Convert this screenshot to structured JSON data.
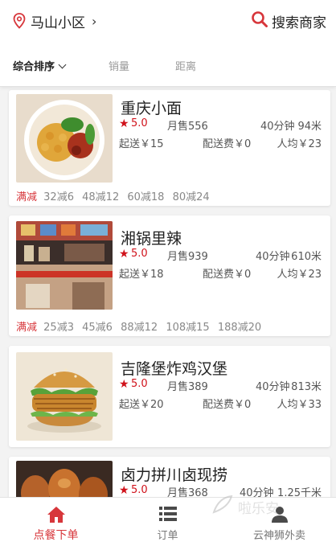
{
  "header": {
    "location": "马山小区",
    "search_label": "搜索商家"
  },
  "sort_tabs": [
    "综合排序",
    "销量",
    "距离"
  ],
  "shops": [
    {
      "name": "重庆小面",
      "rating": "5.0",
      "monthly_sales": "月售556",
      "time": "40分钟",
      "distance": "94米",
      "min_order": "起送￥15",
      "delivery_fee": "配送费￥0",
      "per_capita": "人均￥23",
      "promo_tag": "满减",
      "promos": [
        "32减6",
        "48减12",
        "60减18",
        "80减24"
      ]
    },
    {
      "name": "湘锅里辣",
      "rating": "5.0",
      "monthly_sales": "月售939",
      "time": "40分钟",
      "distance": "610米",
      "min_order": "起送￥18",
      "delivery_fee": "配送费￥0",
      "per_capita": "人均￥23",
      "promo_tag": "满减",
      "promos": [
        "25减3",
        "45减6",
        "88减12",
        "108减15",
        "188减20"
      ]
    },
    {
      "name": "吉隆堡炸鸡汉堡",
      "rating": "5.0",
      "monthly_sales": "月售389",
      "time": "40分钟",
      "distance": "813米",
      "min_order": "起送￥20",
      "delivery_fee": "配送费￥0",
      "per_capita": "人均￥33"
    },
    {
      "name": "卤力拼川卤现捞",
      "rating": "5.0",
      "monthly_sales": "月售368",
      "time": "40分钟",
      "distance": "1.25千米"
    }
  ],
  "tabbar": [
    {
      "label": "点餐下单",
      "icon": "home-icon",
      "active": true
    },
    {
      "label": "订单",
      "icon": "list-icon",
      "active": false
    },
    {
      "label": "云神狮外卖",
      "icon": "user-icon",
      "active": false
    }
  ],
  "watermark": "啦乐安",
  "colors": {
    "accent": "#d7363b",
    "star": "#d0121b",
    "background": "#f3f3f3"
  }
}
